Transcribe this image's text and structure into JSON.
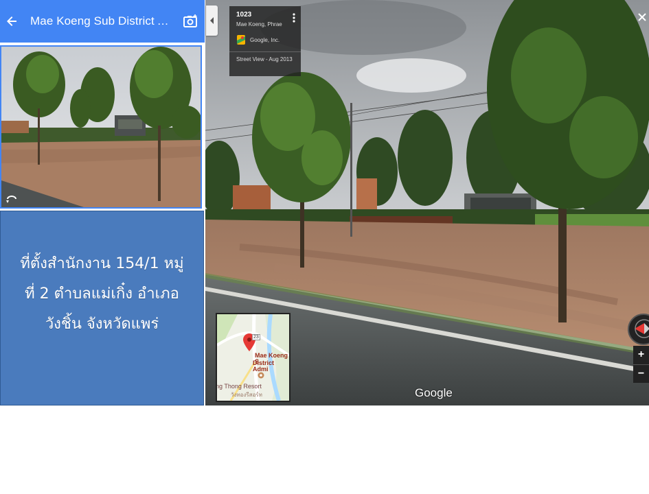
{
  "panel": {
    "title": "Mae Koeng Sub District Ad...",
    "info_text_line1": "ที่ตั้งสำนักงาน 154/1  หมู่",
    "info_text_line2": "ที่  2 ตำบลแม่เกิ๋ง  อำเภอ",
    "info_text_line3": "วังชิ้น จังหวัดแพร่"
  },
  "street_view_card": {
    "title": "1023",
    "subtitle": "Mae Koeng, Phrae",
    "owner": "Google, Inc.",
    "date": "Street View - Aug 2013"
  },
  "minimap": {
    "place_label_line1": "Mae Koeng S",
    "place_label_line2": "District Admi",
    "route_number": "23",
    "resort_label": "ng Thong Resort",
    "resort_label_thai": "วังทองรีสอร์ท"
  },
  "controls": {
    "zoom_in": "+",
    "zoom_out": "−",
    "close": "×",
    "watermark": "Google"
  },
  "colors": {
    "header_blue": "#4285f4",
    "info_box_blue": "#4a7bbd",
    "map_pin_red": "#e53935"
  },
  "icons": [
    "back-arrow-icon",
    "add-photo-icon",
    "photo-360-icon",
    "collapse-chevron-icon",
    "more-vert-icon",
    "pegman-icon",
    "close-icon",
    "compass-icon",
    "map-pin-icon"
  ]
}
